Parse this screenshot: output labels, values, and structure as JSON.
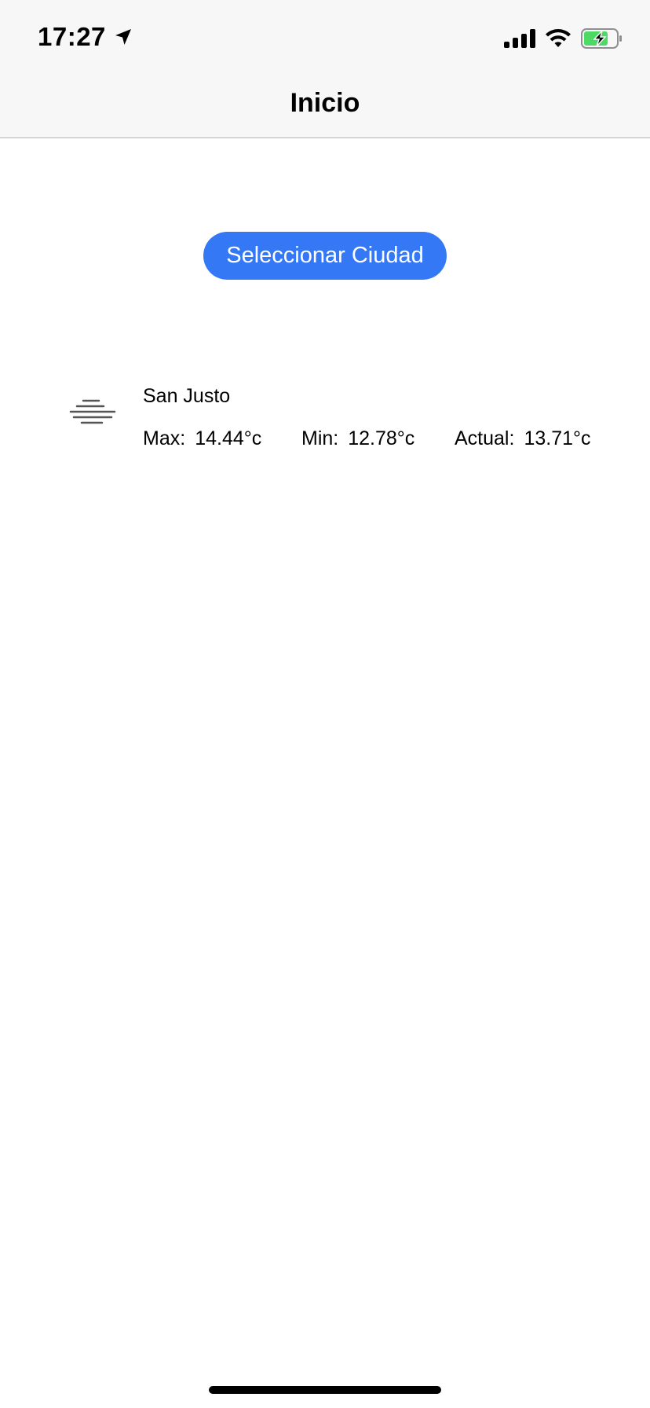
{
  "status_bar": {
    "time": "17:27",
    "icons": [
      "location-arrow-icon",
      "cellular-signal-icon",
      "wifi-icon",
      "battery-charging-icon"
    ],
    "battery_color": "#4cd964"
  },
  "nav": {
    "title": "Inicio"
  },
  "main": {
    "select_city_button": "Seleccionar Ciudad",
    "button_color": "#3478f6",
    "weather": {
      "icon": "fog-icon",
      "city": "San Justo",
      "max_label": "Max:",
      "max_value": "14.44°c",
      "min_label": "Min:",
      "min_value": "12.78°c",
      "current_label": "Actual:",
      "current_value": "13.71°c"
    }
  }
}
